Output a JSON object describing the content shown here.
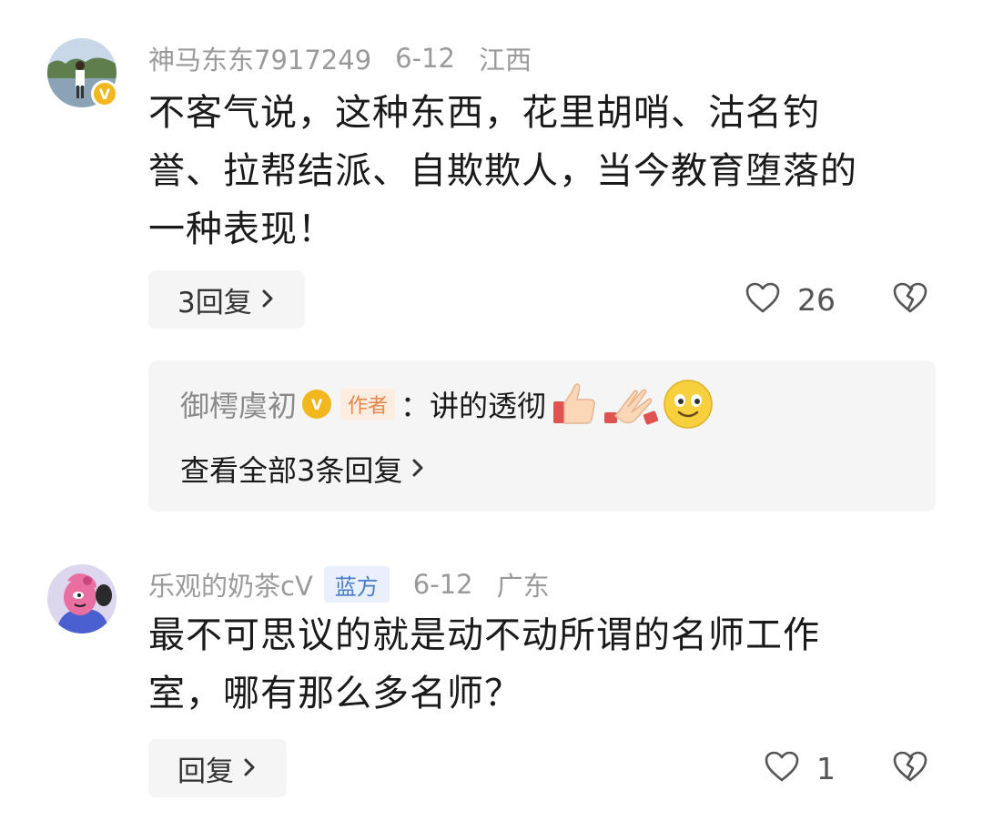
{
  "comments": [
    {
      "username": "神马东东7917249",
      "date": "6-12",
      "location": "江西",
      "verified_badge": "V",
      "text_lines": [
        "不客气说，这种东西，花里胡哨、沽名钓",
        "誉、拉帮结派、自欺欺人，当今教育堕落的",
        "一种表现！"
      ],
      "reply_button": "3回复",
      "likes": "26",
      "sub_reply": {
        "username": "御樗虞初",
        "verified_badge": "V",
        "author_tag": "作者",
        "colon": "：",
        "text": "讲的透彻",
        "emojis": [
          "thumbs-up-icon",
          "clapping-hands-icon",
          "smiling-face-icon"
        ],
        "view_all": "查看全部3条回复"
      }
    },
    {
      "username": "乐观的奶茶cV",
      "tag": "蓝方",
      "date": "6-12",
      "location": "广东",
      "text_lines": [
        "最不可思议的就是动不动所谓的名师工作",
        "室，哪有那么多名师？"
      ],
      "reply_button": "回复",
      "likes": "1"
    }
  ],
  "icons": {
    "like": "heart-outline-icon",
    "dislike": "broken-heart-icon",
    "chevron": "chevron-right-icon"
  },
  "colors": {
    "badge_gold": "#f2b71f",
    "tag_blue": "#4a7cc9",
    "author_tag": "#e5874a",
    "meta_gray": "#9a9a9a"
  }
}
